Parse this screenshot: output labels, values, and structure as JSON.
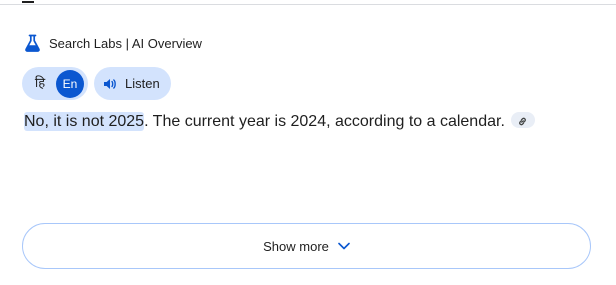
{
  "header": {
    "icon": "flask-icon",
    "title": "Search Labs | AI Overview"
  },
  "language_toggle": {
    "hindi_label": "हि",
    "english_label": "En",
    "selected": "En",
    "active_color": "#0b57d0",
    "pill_color": "#d3e3fd"
  },
  "listen": {
    "icon": "speaker-icon",
    "label": "Listen"
  },
  "answer": {
    "highlighted": "No, it is not 2025",
    "rest": ". The current year is 2024, according to a calendar.",
    "highlight_color": "#d3e3fd",
    "link_icon": "link-icon"
  },
  "show_more": {
    "label": "Show more",
    "icon": "chevron-down-icon",
    "border_color": "#a8c7fa"
  }
}
